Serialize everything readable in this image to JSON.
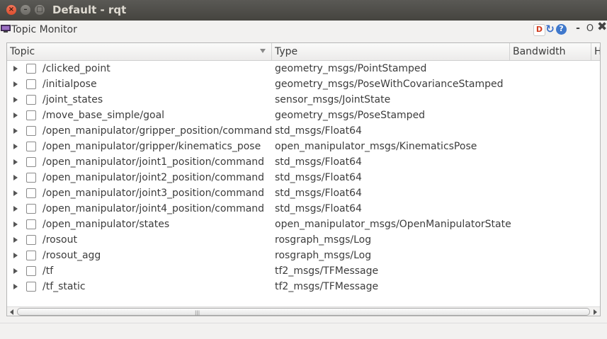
{
  "window": {
    "title": "Default - rqt",
    "buttons": {
      "close": "×",
      "minimize": "–",
      "maximize": "□"
    }
  },
  "plugin": {
    "title": "Topic Monitor",
    "icon": "monitor-icon",
    "header_buttons": {
      "d": "D",
      "reload": "↻",
      "help": "?",
      "dash": "-",
      "o": "O",
      "x": "✖"
    }
  },
  "table": {
    "columns": [
      "Topic",
      "Type",
      "Bandwidth",
      "H"
    ],
    "rows": [
      {
        "topic": "/clicked_point",
        "type": "geometry_msgs/PointStamped"
      },
      {
        "topic": "/initialpose",
        "type": "geometry_msgs/PoseWithCovarianceStamped"
      },
      {
        "topic": "/joint_states",
        "type": "sensor_msgs/JointState"
      },
      {
        "topic": "/move_base_simple/goal",
        "type": "geometry_msgs/PoseStamped"
      },
      {
        "topic": "/open_manipulator/gripper_position/command",
        "type": "std_msgs/Float64"
      },
      {
        "topic": "/open_manipulator/gripper/kinematics_pose",
        "type": "open_manipulator_msgs/KinematicsPose"
      },
      {
        "topic": "/open_manipulator/joint1_position/command",
        "type": "std_msgs/Float64"
      },
      {
        "topic": "/open_manipulator/joint2_position/command",
        "type": "std_msgs/Float64"
      },
      {
        "topic": "/open_manipulator/joint3_position/command",
        "type": "std_msgs/Float64"
      },
      {
        "topic": "/open_manipulator/joint4_position/command",
        "type": "std_msgs/Float64"
      },
      {
        "topic": "/open_manipulator/states",
        "type": "open_manipulator_msgs/OpenManipulatorState"
      },
      {
        "topic": "/rosout",
        "type": "rosgraph_msgs/Log"
      },
      {
        "topic": "/rosout_agg",
        "type": "rosgraph_msgs/Log"
      },
      {
        "topic": "/tf",
        "type": "tf2_msgs/TFMessage"
      },
      {
        "topic": "/tf_static",
        "type": "tf2_msgs/TFMessage"
      }
    ]
  },
  "colors": {
    "accent_close": "#de4f2f",
    "titlebar": "#45443f",
    "help_blue": "#3f78cc"
  }
}
